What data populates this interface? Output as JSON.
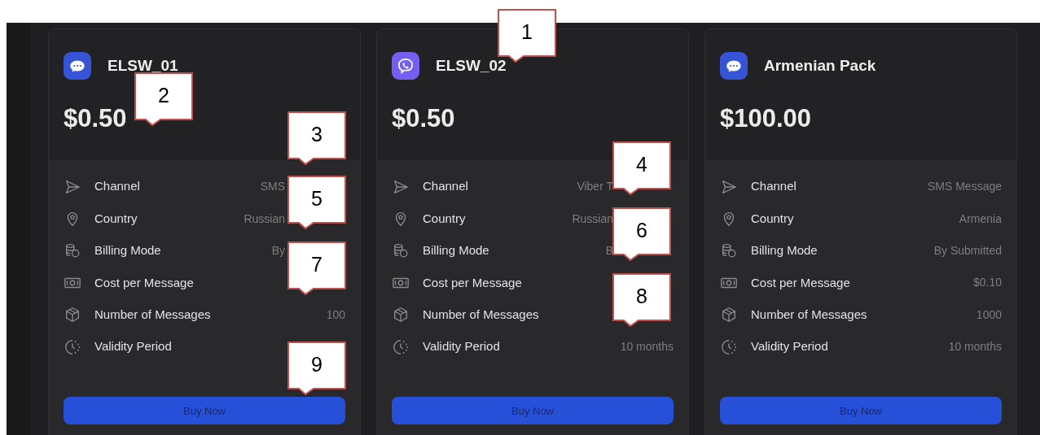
{
  "cards": [
    {
      "kind": "chat",
      "title": "ELSW_01",
      "price": "$0.50",
      "button": "Buy Now",
      "rows": [
        {
          "label": "Channel",
          "value": "SMS"
        },
        {
          "label": "Country",
          "value": "Russian"
        },
        {
          "label": "Billing Mode",
          "value": "By"
        },
        {
          "label": "Cost per Message"
        },
        {
          "label": "Number of Messages",
          "value": "100"
        },
        {
          "label": "Validity Period"
        }
      ]
    },
    {
      "kind": "phone",
      "title": "ELSW_02",
      "price": "$0.50",
      "button": "Buy Now",
      "rows": [
        {
          "label": "Channel",
          "value": "Viber T"
        },
        {
          "label": "Country",
          "value": "Russian"
        },
        {
          "label": "Billing Mode",
          "value": "B"
        },
        {
          "label": "Cost per Message"
        },
        {
          "label": "Number of Messages"
        },
        {
          "label": "Validity Period",
          "value": "10 months"
        }
      ]
    },
    {
      "kind": "chat",
      "title": "Armenian Pack",
      "price": "$100.00",
      "button": "Buy Now",
      "rows": [
        {
          "label": "Channel",
          "value": "SMS Message"
        },
        {
          "label": "Country",
          "value": "Armenia"
        },
        {
          "label": "Billing Mode",
          "value": "By Submitted"
        },
        {
          "label": "Cost per Message",
          "value": "$0.10"
        },
        {
          "label": "Number of Messages",
          "value": "1000"
        },
        {
          "label": "Validity Period",
          "value": "10 months"
        }
      ]
    }
  ],
  "callouts": [
    {
      "label": "1"
    },
    {
      "label": "2"
    },
    {
      "label": "3"
    },
    {
      "label": "4"
    },
    {
      "label": "5"
    },
    {
      "label": "6"
    },
    {
      "label": "7"
    },
    {
      "label": "8"
    },
    {
      "label": "9"
    }
  ]
}
